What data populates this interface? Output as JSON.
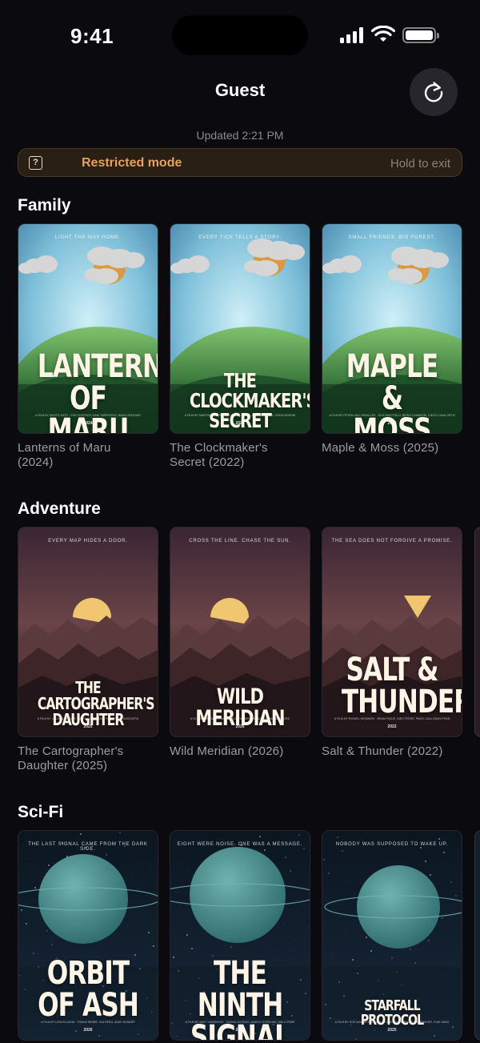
{
  "status_bar": {
    "time": "9:41"
  },
  "header": {
    "title": "Guest",
    "updated": "Updated 2:21 PM"
  },
  "banner": {
    "icon": "question-box-icon",
    "icon_glyph": "?",
    "label": "Restricted mode",
    "hold_text": "Hold to exit"
  },
  "colors": {
    "background": "#0b0b0f",
    "accent_banner": "#e7a15a",
    "caption": "#9c9ca3"
  },
  "sections": [
    {
      "title": "Family",
      "theme": "day",
      "items": [
        {
          "caption": "Lanterns of Maru\n(2024)",
          "tagline": "Light the way home.",
          "title": "LANTERNS\nOF MARU",
          "credits": "A FILM BY NAOTO SATO · EVE KOSTROV, DANI TARROGRO, IMANI OKEZARO",
          "year": "2024"
        },
        {
          "caption": "The Clockmaker's\nSecret (2022)",
          "tagline": "Every tick tells a story.",
          "title": "THE CLOCKMAKER'S\nSECRET",
          "credits": "A FILM BY MARTIN HUBERT · LUCY HALL-HUME, NOAH OSWALD, SOFIA NORDIN",
          "year": "2022"
        },
        {
          "caption": "Maple & Moss (2025)",
          "tagline": "Small friends. Big forest.",
          "title": "MAPLE\n& MOSS",
          "credits": "A FILM BY PETRA HALLORAN-LEE · GUS WHITFIELD, BERNI CAMARON, DIEGO LUNA ORTIZ",
          "year": "2025"
        }
      ]
    },
    {
      "title": "Adventure",
      "theme": "dusk",
      "items": [
        {
          "caption": "The Cartographer's\nDaughter (2025)",
          "tagline": "Every map hides a door.",
          "title": "THE CARTOGRAPHER'S\nDAUGHTER",
          "credits": "A FILM BY LUCA OLLANDER · NORA GOEL, ALBIE FINN, PRIYA DASGUPTA",
          "year": "2025"
        },
        {
          "caption": "Wild Meridian (2026)",
          "tagline": "Cross the line. Chase the sun.",
          "title": "WILD MERIDIAN",
          "credits": "A FILM BY ANA MARCHANT · FELIX ROMERO, NIKA BOLT, BEN ASHFORD",
          "year": "2026"
        },
        {
          "caption": "Salt & Thunder (2022)",
          "tagline": "The sea does not forgive a promise.",
          "title": "SALT &\nTHUNDER",
          "credits": "A FILM BY RAFAEL HEDMARK · BRAM PIQUE, INES FERRE, PAVEL GALLOWAY-PENN",
          "year": "2022"
        }
      ]
    },
    {
      "title": "Sci-Fi",
      "theme": "space",
      "items": [
        {
          "caption": "",
          "tagline": "The last signal came from the dark side.",
          "title": "ORBIT\nOF ASH",
          "credits": "A FILM BY LIRA ELLISON · TOMAS BESTE, DUI REED, ADAH SUNDBY",
          "year": "2026"
        },
        {
          "caption": "",
          "tagline": "Eight were noise. One was a message.",
          "title": "THE NINTH\nSIGNAL",
          "credits": "A FILM BY MATT HARDWICK · SASHA LECROIX, MARCO STERLING, AMI LI PARK",
          "year": "2026"
        },
        {
          "caption": "",
          "tagline": "Nobody was supposed to wake up.",
          "title": "STARFALL PROTOCOL",
          "credits": "A FILM BY EGE MAMAR AUZ · CHLOE DRISSEL, MARCUS OBERMAYER, YUKI SANO",
          "year": "2025"
        }
      ]
    }
  ]
}
